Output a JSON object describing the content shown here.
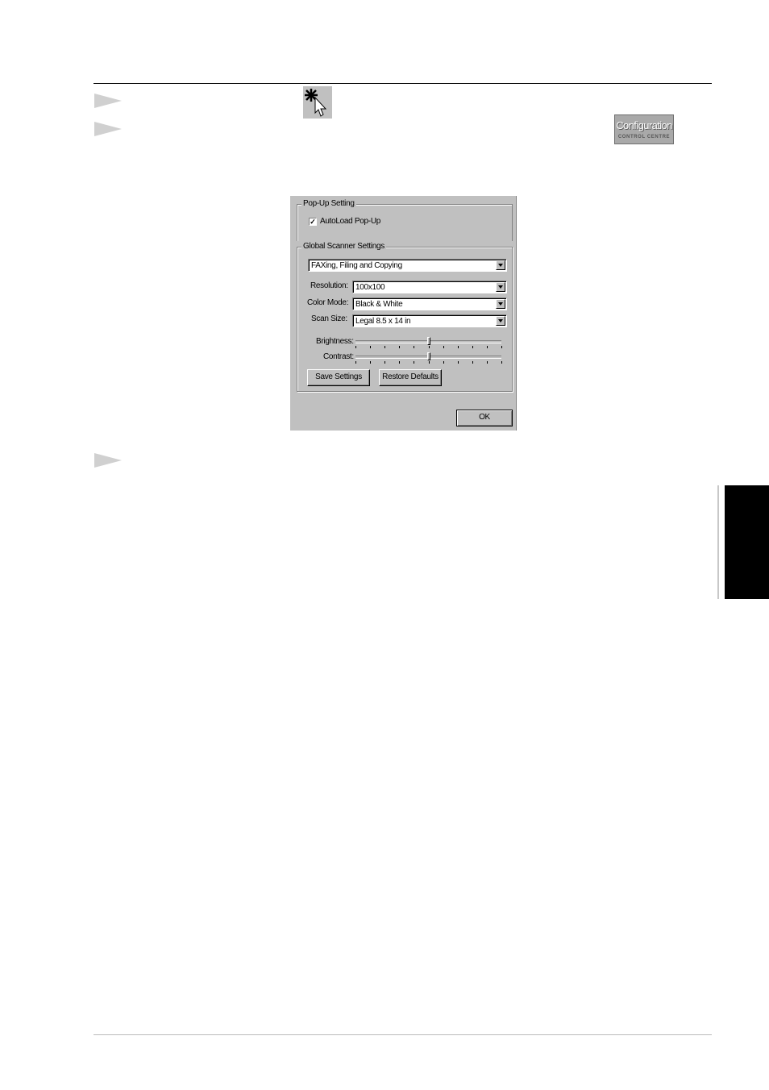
{
  "icons": {
    "wizard": "wizard-cursor-icon"
  },
  "config_button": {
    "main": "Configuration",
    "sub": "CONTROL CENTRE"
  },
  "dialog": {
    "popup_group": {
      "title": "Pop-Up Setting",
      "autoload_label": "AutoLoad Pop-Up",
      "autoload_checked": true
    },
    "scanner_group": {
      "title": "Global Scanner Settings",
      "mode_value": "FAXing, Filing and Copying",
      "resolution_label": "Resolution:",
      "resolution_value": "100x100",
      "color_mode_label": "Color Mode:",
      "color_mode_value": "Black & White",
      "scan_size_label": "Scan Size:",
      "scan_size_value": "Legal 8.5 x 14 in",
      "brightness_label": "Brightness:",
      "brightness_level": 0.5,
      "contrast_label": "Contrast:",
      "contrast_level": 0.5,
      "save_button": "Save Settings",
      "restore_button": "Restore Defaults"
    },
    "ok_button": "OK"
  }
}
